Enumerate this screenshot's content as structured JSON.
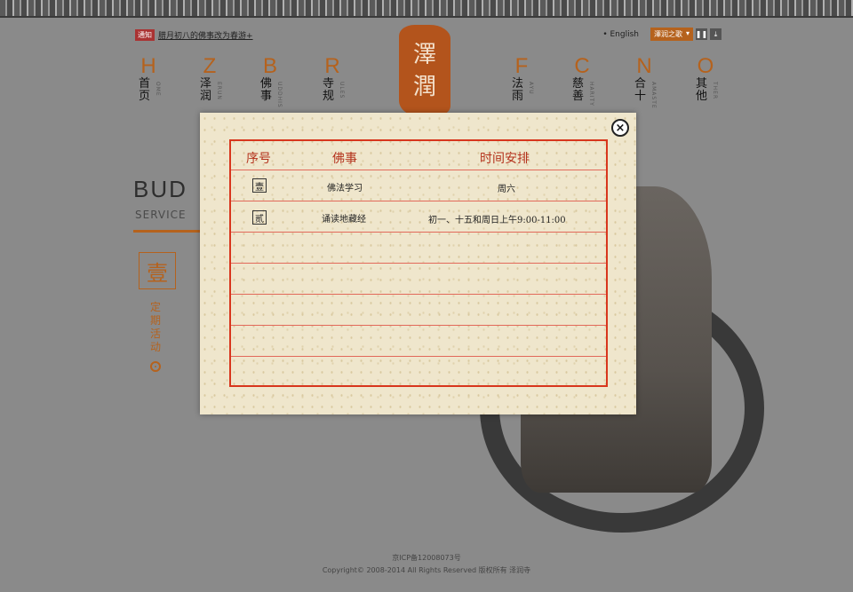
{
  "header": {
    "notice_tag": "通知",
    "notice_text": "腊月初八的佛事改为春游+",
    "language": "• English",
    "music_label": "澤润之歌",
    "music_dropdown_icon": "▾",
    "pause_icon": "❚❚",
    "download_icon": "⤓",
    "logo_chars": [
      "澤",
      "潤"
    ]
  },
  "nav": [
    {
      "letter": "H",
      "cn": "首页",
      "en": "OME"
    },
    {
      "letter": "Z",
      "cn": "泽润",
      "en": "ERUN"
    },
    {
      "letter": "B",
      "cn": "佛事",
      "en": "UDDHIS"
    },
    {
      "letter": "R",
      "cn": "寺规",
      "en": "ULES"
    },
    {
      "letter": "F",
      "cn": "法雨",
      "en": "AYU"
    },
    {
      "letter": "C",
      "cn": "慈善",
      "en": "HARITY"
    },
    {
      "letter": "N",
      "cn": "合十",
      "en": "AMASTE"
    },
    {
      "letter": "O",
      "cn": "其他",
      "en": "THER"
    }
  ],
  "section": {
    "title": "BUD",
    "subtitle": "SERVICE",
    "item_number": "壹",
    "item_label": "定期活动"
  },
  "modal": {
    "close_icon": "×",
    "headers": [
      "序号",
      "佛事",
      "时间安排"
    ],
    "rows": [
      {
        "num": "壹",
        "event": "佛法学习",
        "time": "周六"
      },
      {
        "num": "贰",
        "event": "诵读地藏经",
        "time": "初一、十五和周日上午9:00-11:00"
      }
    ]
  },
  "footer": {
    "icp": "京ICP备12008073号",
    "copyright": "Copyright© 2008-2014 All Rights Reserved 版权所有 泽润寺"
  },
  "colors": {
    "accent": "#b5621d",
    "table_red": "#d8361d",
    "paper": "#efe6cc",
    "background": "#8a8a8a"
  }
}
